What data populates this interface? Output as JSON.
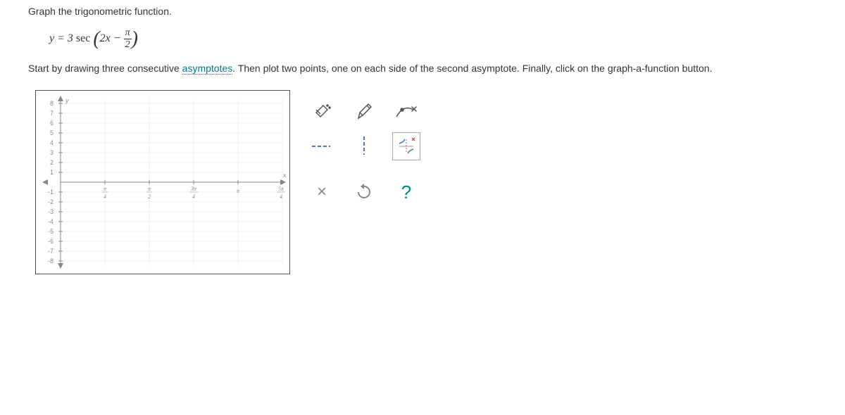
{
  "header": {
    "title": "Graph the trigonometric function."
  },
  "equation": {
    "prefix": "y = 3 ",
    "func": "sec",
    "inner_prefix": "2x − ",
    "frac_num": "π",
    "frac_den": "2"
  },
  "instructions": {
    "part1": "Start by drawing three consecutive ",
    "link": "asymptotes",
    "part2": ". Then plot two points, one on each side of the second asymptote. Finally, click on the graph-a-function button."
  },
  "graph": {
    "y_ticks": [
      "8",
      "7",
      "6",
      "5",
      "4",
      "3",
      "2",
      "1",
      "-1",
      "-2",
      "-3",
      "-4",
      "-5",
      "-6",
      "-7",
      "-8"
    ],
    "x_ticks": [
      {
        "num": "π",
        "den": "4"
      },
      {
        "num": "π",
        "den": "2"
      },
      {
        "num": "3π",
        "den": "4"
      },
      {
        "num": "π",
        "den": ""
      },
      {
        "num": "5π",
        "den": "4"
      }
    ],
    "x_axis_label": "x",
    "y_axis_label": "y"
  },
  "tools": {
    "eraser": "eraser",
    "pencil": "pencil",
    "curve": "curve",
    "hdash": "h-dash",
    "vdash": "v-dash",
    "asymptote": "asymptote-tool",
    "delete": "×",
    "undo": "↺",
    "help": "?"
  }
}
